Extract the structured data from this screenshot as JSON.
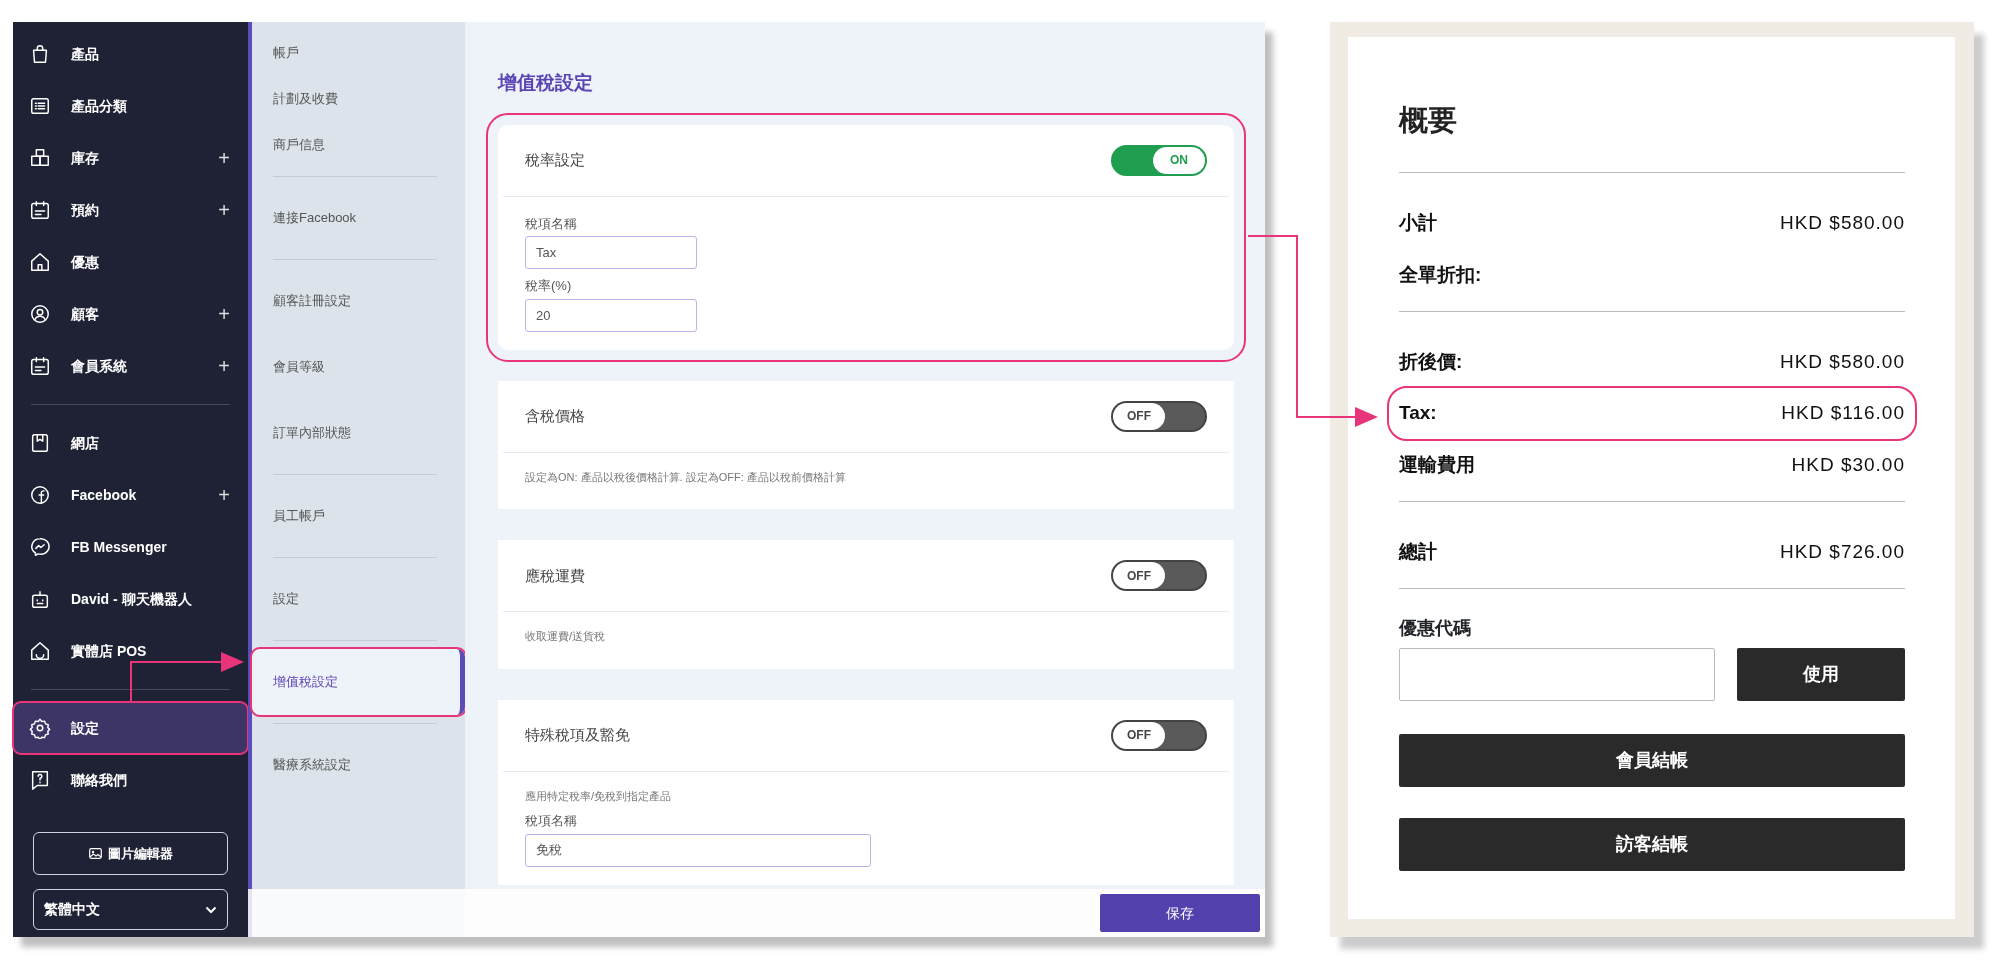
{
  "sidebar": {
    "sections": [
      [
        {
          "label": "產品",
          "selected": false,
          "highlighted": false
        },
        {
          "label": "產品分類",
          "selected": false,
          "highlighted": false
        },
        {
          "label": "庫存",
          "expand": "+",
          "selected": false,
          "highlighted": false
        },
        {
          "label": "預約",
          "expand": "+",
          "selected": false,
          "highlighted": false
        },
        {
          "label": "優惠",
          "selected": false,
          "highlighted": false
        },
        {
          "label": "顧客",
          "expand": "+",
          "selected": false,
          "highlighted": false
        },
        {
          "label": "會員系統",
          "expand": "+",
          "selected": false,
          "highlighted": false
        }
      ],
      [
        {
          "label": "網店",
          "selected": false,
          "highlighted": false
        },
        {
          "label": "Facebook",
          "expand": "+",
          "selected": false,
          "highlighted": false
        },
        {
          "label": "FB Messenger",
          "selected": false,
          "highlighted": false
        },
        {
          "label": "David - 聊天機器人",
          "selected": false,
          "highlighted": false
        },
        {
          "label": "實體店 POS",
          "selected": false,
          "highlighted": false
        }
      ],
      [
        {
          "label": "設定",
          "selected": true,
          "highlighted": true
        },
        {
          "label": "聯絡我們",
          "selected": false,
          "highlighted": false
        }
      ]
    ],
    "image_editor_button": "圖片編輯器",
    "language_select": "繁體中文"
  },
  "submenu": {
    "groups": [
      [
        {
          "label": "帳戶",
          "selected": false,
          "highlighted": false
        },
        {
          "label": "計劃及收費",
          "selected": false,
          "highlighted": false
        },
        {
          "label": "商戶信息",
          "selected": false,
          "highlighted": false
        }
      ],
      [
        {
          "label": "連接Facebook",
          "selected": false,
          "highlighted": false
        }
      ],
      [
        {
          "label": "顧客註冊設定",
          "selected": false,
          "highlighted": false
        },
        {
          "label": "會員等級",
          "selected": false,
          "highlighted": false
        },
        {
          "label": "訂單內部狀態",
          "selected": false,
          "highlighted": false
        }
      ],
      [
        {
          "label": "員工帳戶",
          "selected": false,
          "highlighted": false
        }
      ],
      [
        {
          "label": "設定",
          "selected": false,
          "highlighted": false
        }
      ],
      [
        {
          "label": "增值稅設定",
          "selected": true,
          "highlighted": true
        }
      ],
      [
        {
          "label": "醫療系統設定",
          "selected": false,
          "highlighted": false
        }
      ]
    ]
  },
  "content": {
    "title": "增值稅設定",
    "cards": [
      {
        "title": "稅率設定",
        "toggle": {
          "on": true,
          "label": "ON"
        },
        "highlighted": true,
        "fields": [
          {
            "label": "稅項名稱",
            "value": "Tax",
            "faded": false
          },
          {
            "label": "稅率(%)",
            "value": "20",
            "faded": false
          }
        ]
      },
      {
        "title": "含稅價格",
        "toggle": {
          "on": false,
          "label": "OFF"
        },
        "highlighted": false,
        "description": "設定為ON: 產品以稅後價格計算. 設定為OFF: 產品以稅前價格計算"
      },
      {
        "title": "應稅運費",
        "toggle": {
          "on": false,
          "label": "OFF"
        },
        "highlighted": false,
        "description": "收取運費/送貨稅"
      },
      {
        "title": "特殊稅項及豁免",
        "toggle": {
          "on": false,
          "label": "OFF"
        },
        "highlighted": false,
        "description": "應用特定稅率/免稅到指定產品",
        "fields": [
          {
            "label": "稅項名稱",
            "value": "免稅",
            "faded": false
          }
        ]
      }
    ],
    "save_button": "保存"
  },
  "summary": {
    "title": "概要",
    "sections": [
      [
        {
          "label": "小計",
          "value": "HKD $580.00",
          "highlighted": false
        },
        {
          "label": "全單折扣:",
          "highlighted": false
        }
      ],
      [
        {
          "label": "折後價:",
          "value": "HKD $580.00",
          "highlighted": false
        },
        {
          "label": "Tax:",
          "value": "HKD $116.00",
          "highlighted": true
        },
        {
          "label": "運輸費用",
          "value": "HKD $30.00",
          "highlighted": false
        }
      ],
      [
        {
          "label": "總計",
          "value": "HKD $726.00",
          "highlighted": false
        }
      ]
    ],
    "coupon_label": "優惠代碼",
    "apply_button": "使用",
    "buttons": [
      "會員結帳",
      "訪客結帳"
    ]
  }
}
